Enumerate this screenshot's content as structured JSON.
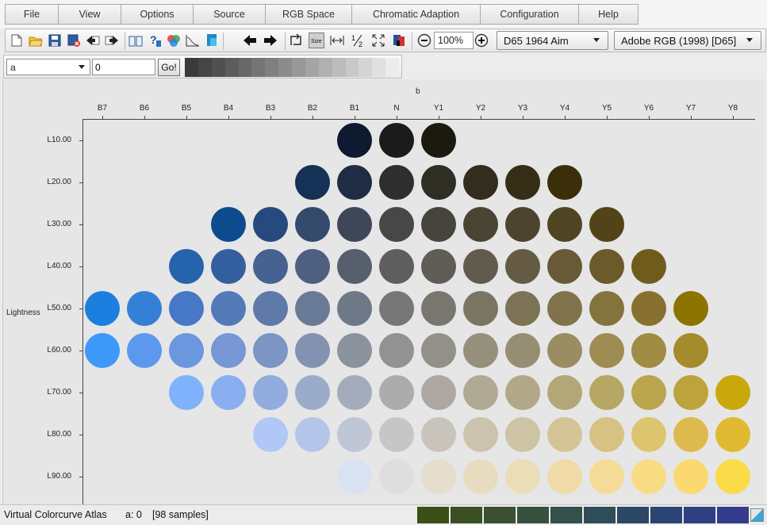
{
  "menu": {
    "items": [
      "File",
      "View",
      "Options",
      "Source",
      "RGB Space",
      "Chromatic Adaption",
      "Configuration",
      "Help"
    ]
  },
  "toolbar": {
    "icons": [
      "new-file-icon",
      "open-folder-icon",
      "save-icon",
      "close-file-icon",
      "back-icon",
      "forward-icon",
      "book-icon",
      "help-icon",
      "color-wheel-icon",
      "curve-icon",
      "swatch-icon",
      "arrow-left-icon",
      "arrow-right-icon",
      "swap-icon",
      "size-icon",
      "fit-width-icon",
      "half-icon",
      "expand-icon",
      "palette-icon",
      "zoom-out-icon",
      "zoom-in-icon"
    ],
    "zoom_value": "100%",
    "illuminant_select": "D65 1964 Aim",
    "rgb_space_select": "Adobe RGB (1998) [D65]"
  },
  "toolbar2": {
    "axis_select": "a",
    "axis_value": "0",
    "go_label": "Go!",
    "gray_strip": [
      "#3a3a3a",
      "#454545",
      "#505050",
      "#5c5c5c",
      "#686868",
      "#747474",
      "#808080",
      "#8c8c8c",
      "#989898",
      "#a4a4a4",
      "#b0b0b0",
      "#bcbcbc",
      "#c8c8c8",
      "#d4d4d4",
      "#e0e0e0",
      "#ececec"
    ]
  },
  "chart_data": {
    "type": "swatch-grid",
    "x_title": "b",
    "y_title": "Lightness",
    "columns": [
      "B7",
      "B6",
      "B5",
      "B4",
      "B3",
      "B2",
      "B1",
      "N",
      "Y1",
      "Y2",
      "Y3",
      "Y4",
      "Y5",
      "Y6",
      "Y7",
      "Y8"
    ],
    "rows": [
      "L10.00",
      "L20.00",
      "L30.00",
      "L40.00",
      "L50.00",
      "L60.00",
      "L70.00",
      "L80.00",
      "L90.00"
    ],
    "samples": [
      [
        "",
        "",
        "",
        "",
        "",
        "",
        "#0d1a30",
        "#1b1b1b",
        "#1c1a10",
        "",
        "",
        "",
        "",
        "",
        "",
        ""
      ],
      [
        "",
        "",
        "",
        "",
        "",
        "#153156",
        "#1f2c44",
        "#2e2e2e",
        "#2f2e24",
        "#322d1c",
        "#352d16",
        "#3a2f0a",
        "",
        "",
        "",
        ""
      ],
      [
        "",
        "",
        "",
        "#0c4b8e",
        "#264a7e",
        "#344a6c",
        "#3e4757",
        "#474747",
        "#47443c",
        "#4a4434",
        "#4d4430",
        "#504522",
        "#534318",
        "",
        "",
        ""
      ],
      [
        "",
        "",
        "#2663ad",
        "#345f9e",
        "#456290",
        "#4f5f7f",
        "#575e6c",
        "#5e5e5e",
        "#5f5d56",
        "#625b4d",
        "#655b44",
        "#685a36",
        "#6d5a2a",
        "#6f5c1d",
        "",
        ""
      ],
      [
        "#1c7fe0",
        "#3580d7",
        "#4778c5",
        "#5479b7",
        "#5f79a9",
        "#697a97",
        "#6f7886",
        "#777777",
        "#78766f",
        "#7a7563",
        "#7c7356",
        "#80734c",
        "#85733e",
        "#887130",
        "#8b7400",
        ""
      ],
      [
        "#3d98f8",
        "#5c99ee",
        "#6b97df",
        "#7697d3",
        "#7b95c4",
        "#8492b1",
        "#8a929e",
        "#929292",
        "#93908a",
        "#968f7c",
        "#978d72",
        "#9a8d62",
        "#9e8c52",
        "#a08c42",
        "#a48b2b",
        ""
      ],
      [
        "",
        "",
        "#7eb3fb",
        "#8aaef0",
        "#93acde",
        "#9baccb",
        "#a4abba",
        "#acacac",
        "#ada9a2",
        "#b0a993",
        "#b1a889",
        "#b3a777",
        "#b7a764",
        "#bba54e",
        "#bda33b",
        "#c8a80a"
      ],
      [
        "",
        "",
        "",
        "",
        "#b1c7f8",
        "#b4c5e9",
        "#bfc6d6",
        "#c6c6c6",
        "#c8c4bb",
        "#cbc3ad",
        "#cdc4a6",
        "#d2c495",
        "#d8c283",
        "#dcc56e",
        "#deb94d",
        "#dfba30"
      ],
      [
        "",
        "",
        "",
        "",
        "",
        "",
        "#d9e2f2",
        "#dedede",
        "#e5ddcd",
        "#e8dcc0",
        "#ecddb9",
        "#f0dba8",
        "#f4dc98",
        "#f8dc83",
        "#fbd96f",
        "#fcdb48"
      ]
    ]
  },
  "status": {
    "app": "Virtual Colorcurve Atlas",
    "axis": "a: 0",
    "count": "[98 samples]",
    "hue_strip": [
      "#3c4f18",
      "#3a5022",
      "#3a5030",
      "#37503e",
      "#32504c",
      "#2f4d58",
      "#2c4866",
      "#2b4474",
      "#2e4082",
      "#353c8c"
    ]
  }
}
